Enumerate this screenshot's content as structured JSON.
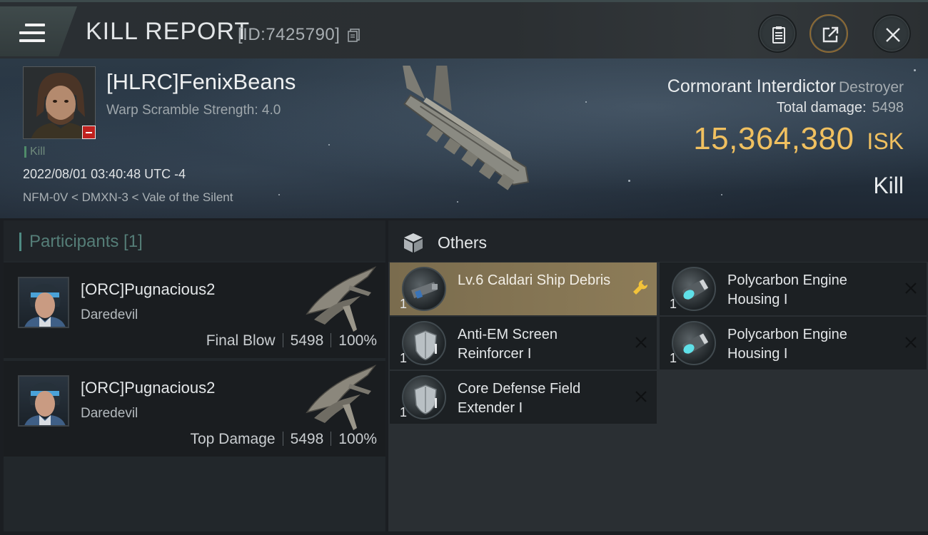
{
  "header": {
    "title": "KILL REPORT",
    "report_id": "[ID:7425790]"
  },
  "victim": {
    "name": "[HLRC]FenixBeans",
    "warp_scramble": "Warp Scramble Strength: 4.0",
    "tag": "Kill",
    "datetime": "2022/08/01 03:40:48 UTC -4",
    "location": "NFM-0V < DMXN-3 < Vale of the Silent",
    "ship_name": "Cormorant Interdictor",
    "ship_class": "Destroyer",
    "total_damage_label": "Total damage:",
    "total_damage_value": "5498",
    "isk_amount": "15,364,380",
    "isk_unit": "ISK",
    "result": "Kill"
  },
  "participants": {
    "label": "Participants [1]",
    "items": [
      {
        "name": "[ORC]Pugnacious2",
        "ship": "Daredevil",
        "role": "Final Blow",
        "damage": "5498",
        "percent": "100%"
      },
      {
        "name": "[ORC]Pugnacious2",
        "ship": "Daredevil",
        "role": "Top Damage",
        "damage": "5498",
        "percent": "100%"
      }
    ]
  },
  "others": {
    "label": "Others",
    "items": [
      {
        "name": "Lv.6 Caldari Ship Debris",
        "qty": "1",
        "icon": "debris-icon"
      },
      {
        "name": "Polycarbon Engine Housing I",
        "qty": "1",
        "icon": "engine-housing-icon"
      },
      {
        "name": "Anti-EM Screen Reinforcer I",
        "qty": "1",
        "icon": "shield-reinforcer-icon"
      },
      {
        "name": "Polycarbon Engine Housing I",
        "qty": "1",
        "icon": "engine-housing-icon"
      },
      {
        "name": "Core Defense Field Extender I",
        "qty": "1",
        "icon": "shield-extender-icon"
      }
    ]
  },
  "colors": {
    "isk_gold": "#f0c060",
    "highlight_item": "#8d7c58",
    "participants_accent": "#4f8b83",
    "kill_tag_green": "#4f8b69",
    "minus_badge_red": "#c0211e"
  }
}
